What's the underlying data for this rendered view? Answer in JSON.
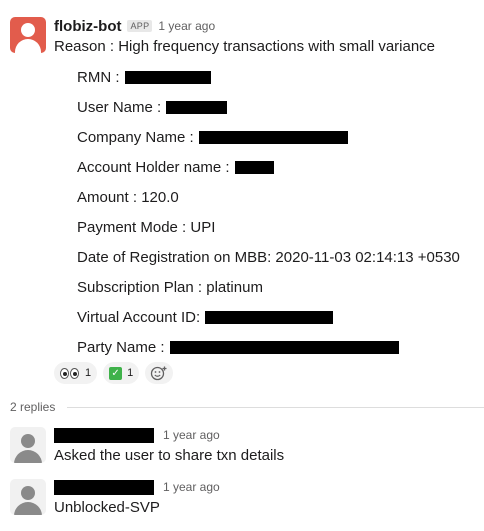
{
  "message": {
    "sender": "flobiz-bot",
    "badge": "APP",
    "time": "1 year ago",
    "reason": "Reason : High frequency transactions with small variance",
    "fields": [
      {
        "label": "RMN :",
        "value": "",
        "redacted": true
      },
      {
        "label": "User Name :",
        "value": "",
        "redacted": true
      },
      {
        "label": "Company Name :",
        "value": "",
        "redacted": true
      },
      {
        "label": "Account Holder name :",
        "value": "",
        "redacted": true
      },
      {
        "label": "Amount : 120.0",
        "value": "",
        "redacted": false
      },
      {
        "label": "Payment Mode : UPI",
        "value": "",
        "redacted": false
      },
      {
        "label": "Date of Registration on MBB: 2020-11-03 02:14:13 +0530",
        "value": "",
        "redacted": false
      },
      {
        "label": "Subscription Plan : platinum",
        "value": "",
        "redacted": false
      },
      {
        "label": "Virtual Account ID:",
        "value": "",
        "redacted": true
      },
      {
        "label": "Party Name :",
        "value": "",
        "redacted": true
      }
    ],
    "reactions": [
      {
        "emoji": "eyes-icon",
        "count": "1"
      },
      {
        "emoji": "white-check-mark-icon",
        "count": "1"
      }
    ],
    "add_reaction_icon": "add-reaction-icon"
  },
  "thread": {
    "replies_count": "2 replies",
    "replies": [
      {
        "time": "1 year ago",
        "text": "Asked the user to share txn details"
      },
      {
        "time": "1 year ago",
        "text": "Unblocked-SVP"
      }
    ]
  },
  "colors": {
    "bot_avatar": "#e25c4c",
    "text": "#1d1c1d",
    "muted": "#616061",
    "reaction_bg": "#f2f2f2",
    "check_green": "#3fb24a"
  }
}
